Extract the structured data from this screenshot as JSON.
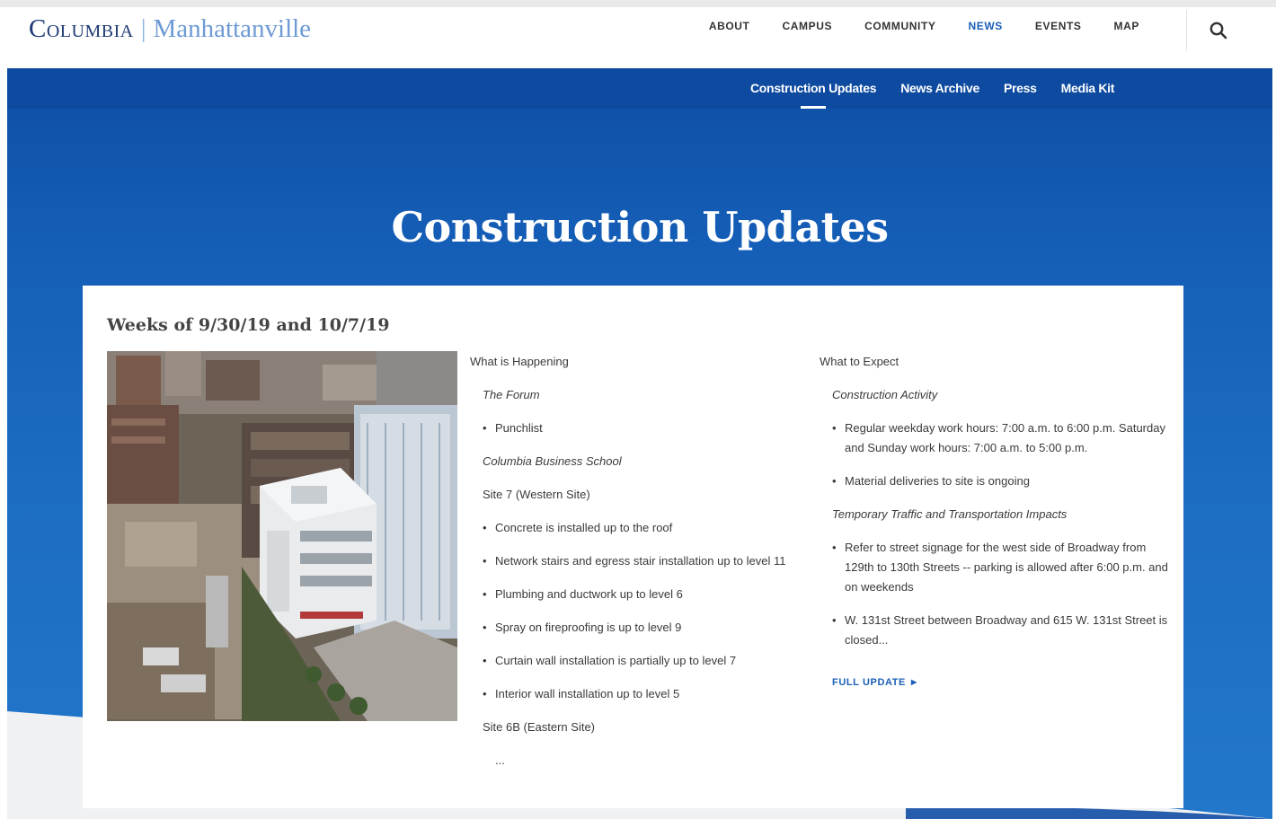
{
  "brand": {
    "name_part1": "Columbia",
    "name_part2": "Manhattanville"
  },
  "main_nav": [
    {
      "label": "ABOUT",
      "active": false
    },
    {
      "label": "CAMPUS",
      "active": false
    },
    {
      "label": "COMMUNITY",
      "active": false
    },
    {
      "label": "NEWS",
      "active": true
    },
    {
      "label": "EVENTS",
      "active": false
    },
    {
      "label": "MAP",
      "active": false
    }
  ],
  "search": {
    "icon": "search-icon"
  },
  "sub_nav": [
    {
      "label": "Construction Updates",
      "active": true
    },
    {
      "label": "News Archive",
      "active": false
    },
    {
      "label": "Press",
      "active": false
    },
    {
      "label": "Media Kit",
      "active": false
    }
  ],
  "hero": {
    "title": "Construction Updates"
  },
  "update": {
    "title": "Weeks of 9/30/19 and 10/7/19",
    "happening": {
      "heading": "What is Happening",
      "forum_label": "The Forum",
      "forum_items": [
        "Punchlist"
      ],
      "cbs_label": "Columbia Business School",
      "site7_label": "Site 7 (Western Site)",
      "site7_items": [
        "Concrete is installed up to the roof",
        "Network stairs and egress stair installation up to level 11",
        "Plumbing and ductwork up to level 6",
        "Spray on fireproofing is up to level 9",
        "Curtain wall installation is partially up to level 7",
        "Interior wall installation up to level 5"
      ],
      "site6b_label": "Site 6B (Eastern Site)",
      "ellipsis": "..."
    },
    "expect": {
      "heading": "What to Expect",
      "activity_label": "Construction Activity",
      "activity_items": [
        "Regular weekday work hours: 7:00 a.m. to 6:00 p.m. Saturday and Sunday work hours: 7:00 a.m. to 5:00 p.m.",
        "Material deliveries to site is ongoing"
      ],
      "traffic_label": "Temporary Traffic and Transportation Impacts",
      "traffic_items": [
        "Refer to street signage for the west side of Broadway from 129th to 130th Streets -- parking is allowed after 6:00 p.m. and on weekends",
        "W. 131st Street between Broadway and 615 W. 131st Street is closed..."
      ],
      "link_label": "FULL UPDATE"
    }
  },
  "colors": {
    "brand_navy": "#1c3a73",
    "brand_light_blue": "#6d9ad4",
    "link_blue": "#1b5fb5",
    "subnav_blue": "#0d4aa0",
    "hero_blue": "#1c6cc3"
  }
}
